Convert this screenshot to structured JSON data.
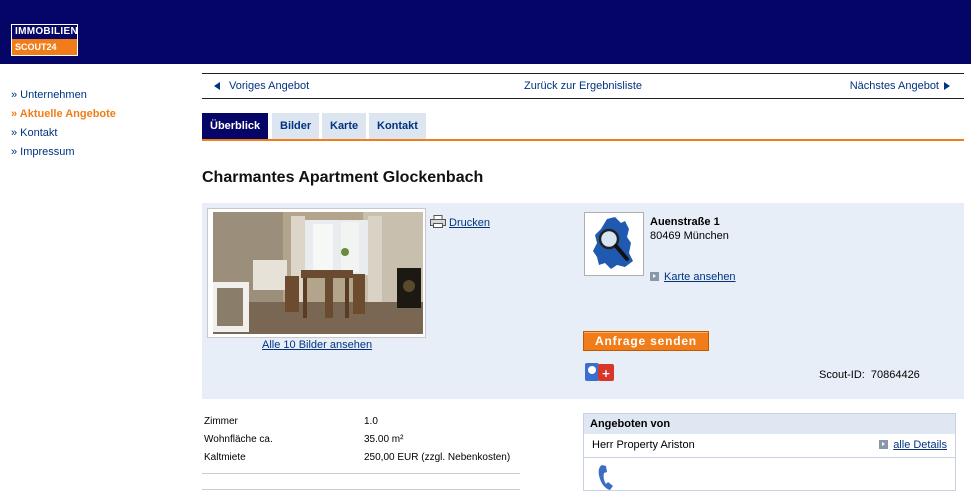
{
  "brand": {
    "line1": "IMMOBILIEN",
    "line2": "SCOUT24"
  },
  "sidebar": {
    "items": [
      {
        "label": "» Unternehmen"
      },
      {
        "label": "» Aktuelle Angebote"
      },
      {
        "label": "» Kontakt"
      },
      {
        "label": "» Impressum"
      }
    ]
  },
  "navbar": {
    "previous": "Voriges Angebot",
    "back_to_results": "Zurück zur Ergebnisliste",
    "next": "Nächstes Angebot"
  },
  "tabs": [
    {
      "label": "Überblick"
    },
    {
      "label": "Bilder"
    },
    {
      "label": "Karte"
    },
    {
      "label": "Kontakt"
    }
  ],
  "listing": {
    "title": "Charmantes Apartment Glockenbach",
    "all_pictures": "Alle 10 Bilder ansehen",
    "print": "Drucken",
    "street": "Auenstraße 1",
    "city": "80469 München",
    "map_link": "Karte ansehen",
    "request_button": "Anfrage senden",
    "scout_id_label": "Scout-ID:",
    "scout_id": "70864426"
  },
  "facts": [
    {
      "key": "Zimmer",
      "value": "1.0"
    },
    {
      "key": "Wohnfläche ca.",
      "value": "35.00 m²"
    },
    {
      "key": "Kaltmiete",
      "value": "250,00 EUR (zzgl. Nebenkosten)"
    }
  ],
  "offered_by": {
    "heading": "Angeboten von",
    "name": "Herr Property Ariston",
    "details_link": "alle Details"
  },
  "colors": {
    "header_bg": "#050568",
    "accent_orange": "#f07d1a",
    "link_blue": "#003380",
    "panel_bg": "#e8eef7"
  },
  "icons": [
    "printer-icon",
    "map-search-icon",
    "social-share-icon",
    "phone-icon",
    "arrow-left-icon",
    "arrow-right-icon"
  ]
}
